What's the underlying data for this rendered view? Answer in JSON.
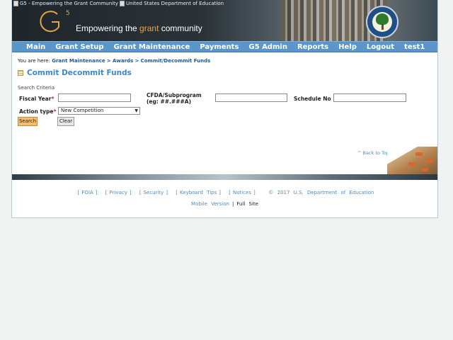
{
  "header": {
    "g5_alt": "G5 - Empowering the Grant Community",
    "ed_alt": "United States Department of Education",
    "tagline_pre": "Empowering the ",
    "tagline_accent": "grant",
    "tagline_post": " community",
    "logo_text": "G",
    "logo_sup": "5"
  },
  "nav": [
    "Main",
    "Grant Setup",
    "Grant Maintenance",
    "Payments",
    "G5 Admin",
    "Reports",
    "Help",
    "Logout",
    "test1"
  ],
  "breadcrumb": {
    "prefix": "You are here:",
    "items": [
      "Grant Maintenance",
      "Awards",
      "Commit/Decommit Funds"
    ],
    "separator": ">"
  },
  "page_title": "Commit Decommit Funds",
  "form": {
    "section_label": "Search Criteria",
    "fiscal_year_label": "Fiscal Year",
    "cfda_label_1": "CFDA/Subprogram",
    "cfda_label_2": "(eg: ##.###A)",
    "schedule_label": "Schedule No",
    "action_type_label": "Action type",
    "required_mark": "*",
    "action_type_value": "New Competition",
    "fiscal_year_value": "",
    "cfda_value": "",
    "schedule_value": "",
    "search_button": "Search",
    "clear_button": "Clear"
  },
  "back_to_top": "^ Back to Top",
  "footer": {
    "links": [
      "FOIA",
      "Privacy",
      "Security",
      "Keyboard Tips",
      "Notices"
    ],
    "copyright": "© 2017 U.S. Department of Education",
    "mobile_version": "Mobile Version",
    "separator": "|",
    "full_site": "Full Site"
  },
  "colors": {
    "nav_bg": "#5b95c9",
    "title": "#3d87c6",
    "link": "#4f8cc4",
    "search_button": "#f6bd6a"
  }
}
